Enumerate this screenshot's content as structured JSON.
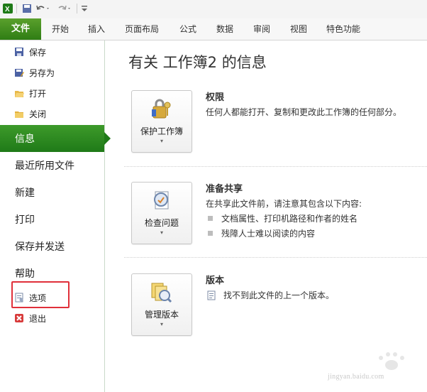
{
  "quick_access": {
    "icons": [
      "excel-icon",
      "save-icon",
      "undo-icon",
      "redo-icon",
      "customize-icon"
    ]
  },
  "ribbon": {
    "file_tab": "文件",
    "tabs": [
      "开始",
      "插入",
      "页面布局",
      "公式",
      "数据",
      "审阅",
      "视图",
      "特色功能"
    ]
  },
  "sidebar": {
    "commands": [
      {
        "label": "保存",
        "icon": "save-icon"
      },
      {
        "label": "另存为",
        "icon": "save-as-icon"
      },
      {
        "label": "打开",
        "icon": "open-folder-icon"
      },
      {
        "label": "关闭",
        "icon": "close-folder-icon"
      }
    ],
    "active": "信息",
    "nav": [
      "最近所用文件",
      "新建",
      "打印",
      "保存并发送",
      "帮助"
    ],
    "options": "选项",
    "exit": "退出"
  },
  "main": {
    "title": "有关 工作簿2 的信息",
    "permissions": {
      "button": "保护工作簿",
      "heading": "权限",
      "text": "任何人都能打开、复制和更改此工作簿的任何部分。"
    },
    "share": {
      "button": "检查问题",
      "heading": "准备共享",
      "text": "在共享此文件前，请注意其包含以下内容:",
      "bullets": [
        "文档属性、打印机路径和作者的姓名",
        "残障人士难以阅读的内容"
      ]
    },
    "versions": {
      "button": "管理版本",
      "heading": "版本",
      "text": "找不到此文件的上一个版本。"
    },
    "dropdown_arrow": "▾"
  },
  "watermark": {
    "text": "jingyan.baidu.com"
  },
  "colors": {
    "accent_green": "#2f7d14",
    "highlight_red": "#e0303a"
  }
}
